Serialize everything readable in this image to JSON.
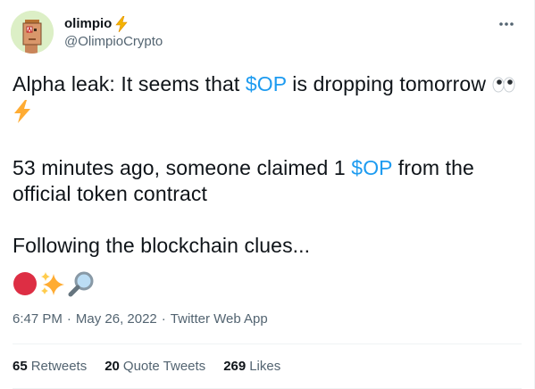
{
  "author": {
    "display_name": "olimpio",
    "handle": "@OlimpioCrypto",
    "badge_icon": "lightning-bolt-icon",
    "avatar_icon": "punk-avatar-icon"
  },
  "tweet": {
    "line1_prefix": "Alpha leak: It seems that ",
    "line1_cashtag": "$OP",
    "line1_suffix": " is dropping tomorrow ",
    "line1_emoji": [
      "eyes-emoji",
      "lightning-emoji"
    ],
    "line2_prefix": "53 minutes ago, someone claimed 1 ",
    "line2_cashtag": "$OP",
    "line2_suffix": " from the official token contract",
    "line3": "Following the blockchain clues...",
    "emoji_row": [
      "red-circle-emoji",
      "sparkles-emoji",
      "magnifying-glass-emoji"
    ]
  },
  "meta": {
    "time": "6:47 PM",
    "separator": "·",
    "date": "May 26, 2022",
    "source": "Twitter Web App"
  },
  "stats": [
    {
      "count": "65",
      "label": "Retweets"
    },
    {
      "count": "20",
      "label": "Quote Tweets"
    },
    {
      "count": "269",
      "label": "Likes"
    }
  ],
  "colors": {
    "link": "#1d9bf0",
    "text": "#0f1419",
    "secondary": "#536471",
    "bolt": "#f4b400"
  }
}
